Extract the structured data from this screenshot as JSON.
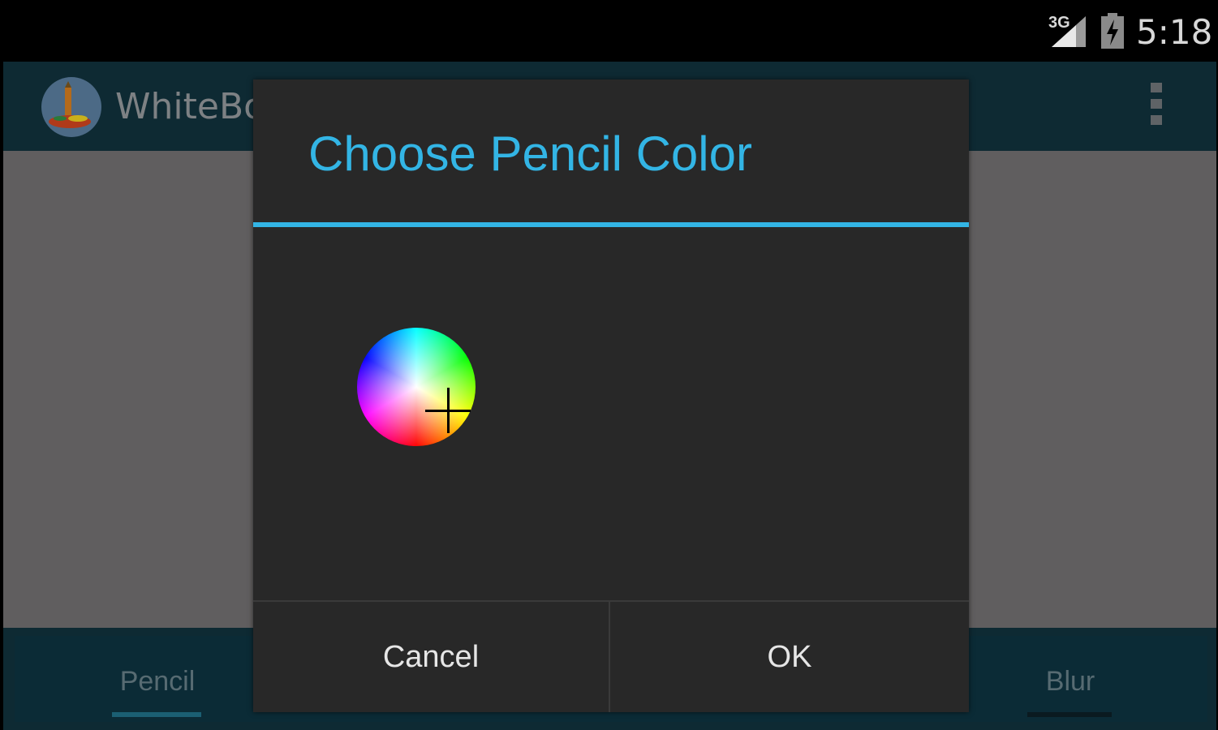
{
  "status_bar": {
    "network_label": "3G",
    "network_icon": "signal-3g-icon",
    "battery_icon": "battery-charging-icon",
    "time": "5:18"
  },
  "action_bar": {
    "app_logo_icon": "whiteboard-app-logo",
    "app_title": "WhiteBo",
    "overflow_icon": "overflow-menu-icon"
  },
  "bottom_tabs": [
    {
      "label": "Pencil",
      "selected": true
    },
    {
      "label": "Blur",
      "selected": false
    }
  ],
  "dialog": {
    "title": "Choose Pencil Color",
    "color_wheel_icon": "color-wheel",
    "crosshair_icon": "crosshair-icon",
    "buttons": {
      "cancel": "Cancel",
      "ok": "OK"
    }
  },
  "colors": {
    "accent": "#33b5e5",
    "dialog_background": "#282828",
    "status_bar_background": "#000000",
    "canvas_dimmed": "#605e5f"
  }
}
